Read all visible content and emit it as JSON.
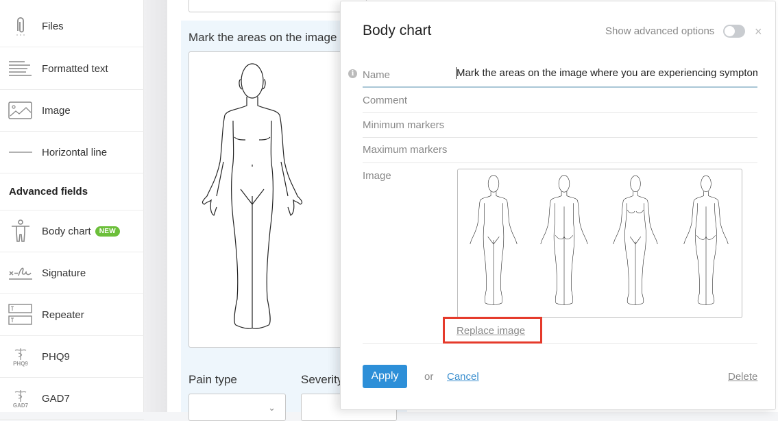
{
  "sidebar": {
    "items": [
      {
        "label": "Files",
        "icon": "paperclip-icon"
      },
      {
        "label": "Formatted text",
        "icon": "formatted-text-icon"
      },
      {
        "label": "Image",
        "icon": "image-icon"
      },
      {
        "label": "Horizontal line",
        "icon": "horizontal-line-icon"
      }
    ],
    "advanced_heading": "Advanced fields",
    "advanced_items": [
      {
        "label": "Body chart",
        "icon": "body-icon",
        "badge": "NEW"
      },
      {
        "label": "Signature",
        "icon": "signature-icon"
      },
      {
        "label": "Repeater",
        "icon": "repeater-icon"
      },
      {
        "label": "PHQ9",
        "icon": "caduceus-icon",
        "icon_caption": "PHQ9"
      },
      {
        "label": "GAD7",
        "icon": "caduceus-icon",
        "icon_caption": "GAD7"
      }
    ]
  },
  "form": {
    "field_title": "Mark the areas on the image where you are experiencing symptoms",
    "pain_type_label": "Pain type",
    "severity_label": "Severity",
    "pain_type_value": "",
    "severity_value": ""
  },
  "modal": {
    "title": "Body chart",
    "advanced_label": "Show advanced options",
    "advanced_enabled": false,
    "close_glyph": "×",
    "fields": {
      "name_label": "Name",
      "name_value": "Mark the areas on the image where you are experiencing symptoms",
      "comment_label": "Comment",
      "comment_value": "",
      "min_label": "Minimum markers",
      "min_value": "",
      "max_label": "Maximum markers",
      "max_value": "",
      "image_label": "Image"
    },
    "image_figures": [
      "male-front",
      "male-back",
      "female-front",
      "female-back"
    ],
    "replace_image_label": "Replace image",
    "highlight_color": "#e53a2b",
    "apply_label": "Apply",
    "or_label": "or",
    "cancel_label": "Cancel",
    "delete_label": "Delete",
    "accent_color": "#2d8fd8"
  }
}
